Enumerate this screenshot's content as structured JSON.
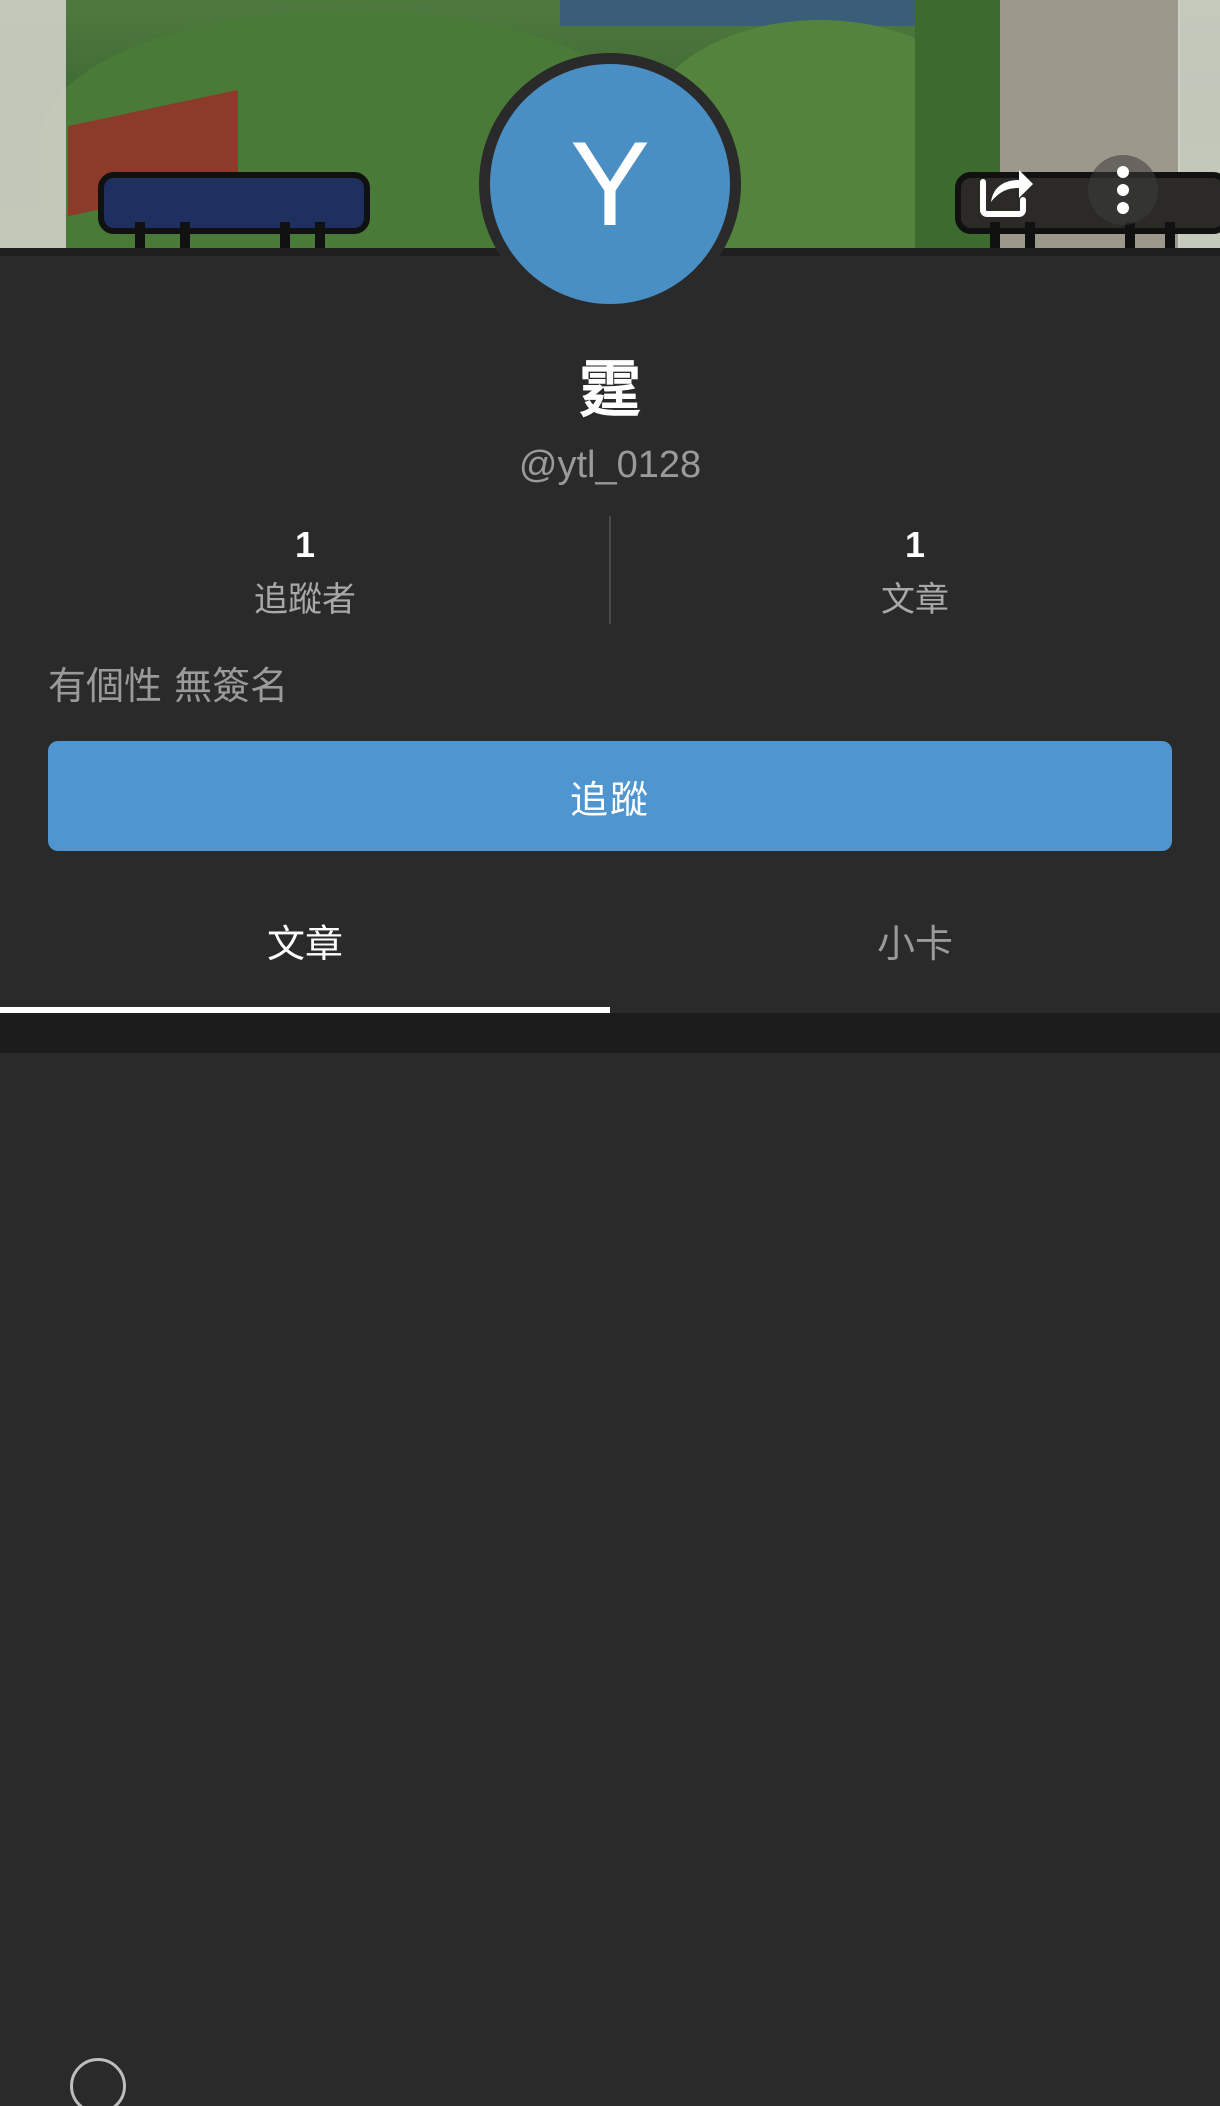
{
  "profile": {
    "avatar_letter": "Y",
    "name": "霆",
    "handle": "@ytl_0128",
    "bio": "有個性 無簽名"
  },
  "stats": [
    {
      "value": "1",
      "label": "追蹤者"
    },
    {
      "value": "1",
      "label": "文章"
    }
  ],
  "actions": {
    "follow_label": "追蹤",
    "share_icon": "share-icon",
    "more_icon": "more-vertical-icon"
  },
  "tabs": [
    {
      "label": "文章",
      "active": true
    },
    {
      "label": "小卡",
      "active": false
    }
  ],
  "colors": {
    "background": "#2a2a2a",
    "accent": "#4f95cf",
    "avatar": "#4a8fc4",
    "muted_text": "#9a9a9a"
  }
}
